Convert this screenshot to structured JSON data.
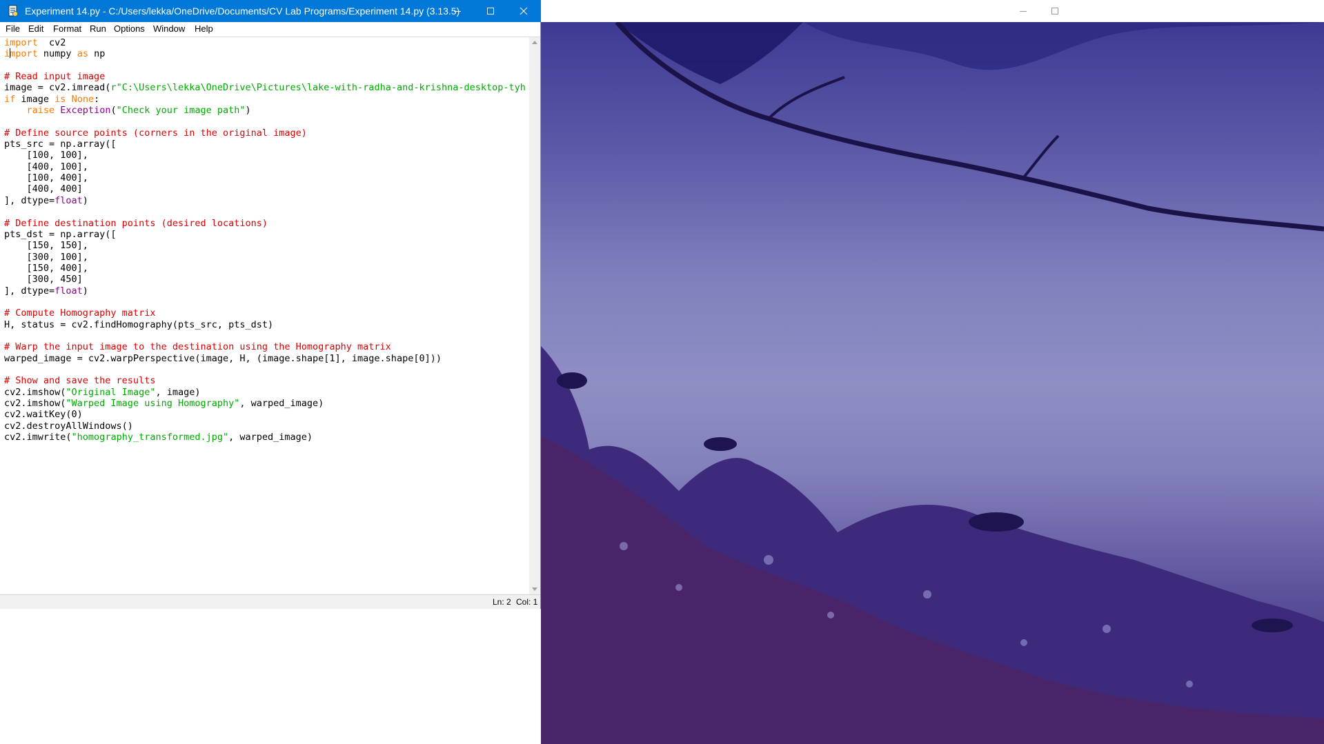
{
  "idle_window": {
    "title": "Experiment 14.py - C:/Users/lekka/OneDrive/Documents/CV Lab Programs/Experiment 14.py (3.13.5)",
    "menu": [
      "File",
      "Edit",
      "Format",
      "Run",
      "Options",
      "Window",
      "Help"
    ],
    "status": {
      "line": "Ln: 2",
      "col": "Col: 1"
    }
  },
  "code_lines": [
    [
      [
        "kw",
        "import"
      ],
      [
        "",
        "  cv2"
      ]
    ],
    [
      [
        "kw",
        "import"
      ],
      [
        "",
        " numpy "
      ],
      [
        "kw",
        "as"
      ],
      [
        "",
        " np"
      ]
    ],
    [],
    [
      [
        "cm",
        "# Read input image"
      ]
    ],
    [
      [
        "",
        "image = cv2.imread("
      ],
      [
        "st",
        "r\"C:\\Users\\lekka\\OneDrive\\Pictures\\lake-with-radha-and-krishna-desktop-tyh"
      ]
    ],
    [
      [
        "kw",
        "if"
      ],
      [
        "",
        " image "
      ],
      [
        "kw",
        "is"
      ],
      [
        " ",
        ""
      ],
      [
        "kw",
        "None"
      ],
      [
        "",
        ":"
      ]
    ],
    [
      [
        "",
        "    "
      ],
      [
        "kw",
        "raise"
      ],
      [
        "",
        " "
      ],
      [
        "bi",
        "Exception"
      ],
      [
        "",
        "("
      ],
      [
        "st",
        "\"Check your image path\""
      ],
      [
        "",
        ")"
      ]
    ],
    [],
    [
      [
        "cm",
        "# Define source points (corners in the original image)"
      ]
    ],
    [
      [
        "",
        "pts_src = np.array(["
      ]
    ],
    [
      [
        "",
        "    [100, 100],"
      ]
    ],
    [
      [
        "",
        "    [400, 100],"
      ]
    ],
    [
      [
        "",
        "    [100, 400],"
      ]
    ],
    [
      [
        "",
        "    [400, 400]"
      ]
    ],
    [
      [
        "",
        "], dtype="
      ],
      [
        "bi",
        "float"
      ],
      [
        "",
        ")"
      ]
    ],
    [],
    [
      [
        "cm",
        "# Define destination points (desired locations)"
      ]
    ],
    [
      [
        "",
        "pts_dst = np.array(["
      ]
    ],
    [
      [
        "",
        "    [150, 150],"
      ]
    ],
    [
      [
        "",
        "    [300, 100],"
      ]
    ],
    [
      [
        "",
        "    [150, 400],"
      ]
    ],
    [
      [
        "",
        "    [300, 450]"
      ]
    ],
    [
      [
        "",
        "], dtype="
      ],
      [
        "bi",
        "float"
      ],
      [
        "",
        ")"
      ]
    ],
    [],
    [
      [
        "cm",
        "# Compute Homography matrix"
      ]
    ],
    [
      [
        "",
        "H, status = cv2.findHomography(pts_src, pts_dst)"
      ]
    ],
    [],
    [
      [
        "cm",
        "# Warp the input image to the destination using the Homography matrix"
      ]
    ],
    [
      [
        "",
        "warped_image = cv2.warpPerspective(image, H, (image.shape[1], image.shape[0]))"
      ]
    ],
    [],
    [
      [
        "cm",
        "# Show and save the results"
      ]
    ],
    [
      [
        "",
        "cv2.imshow("
      ],
      [
        "st",
        "\"Original Image\""
      ],
      [
        "",
        ", image)"
      ]
    ],
    [
      [
        "",
        "cv2.imshow("
      ],
      [
        "st",
        "\"Warped Image using Homography\""
      ],
      [
        "",
        ", warped_image)"
      ]
    ],
    [
      [
        "",
        "cv2.waitKey(0)"
      ]
    ],
    [
      [
        "",
        "cv2.destroyAllWindows()"
      ]
    ],
    [
      [
        "",
        "cv2.imwrite("
      ],
      [
        "st",
        "\"homography_transformed.jpg\""
      ],
      [
        "",
        ", warped_image)"
      ]
    ]
  ],
  "colors": {
    "titlebar": "#0078d7",
    "keyword": "#ff7700",
    "builtin": "#900090",
    "comment": "#dd0000",
    "string": "#00aa00"
  },
  "icons": {
    "idle_app": "python-idle-icon",
    "minimize": "minimize-icon",
    "maximize": "maximize-icon",
    "close": "close-icon"
  }
}
